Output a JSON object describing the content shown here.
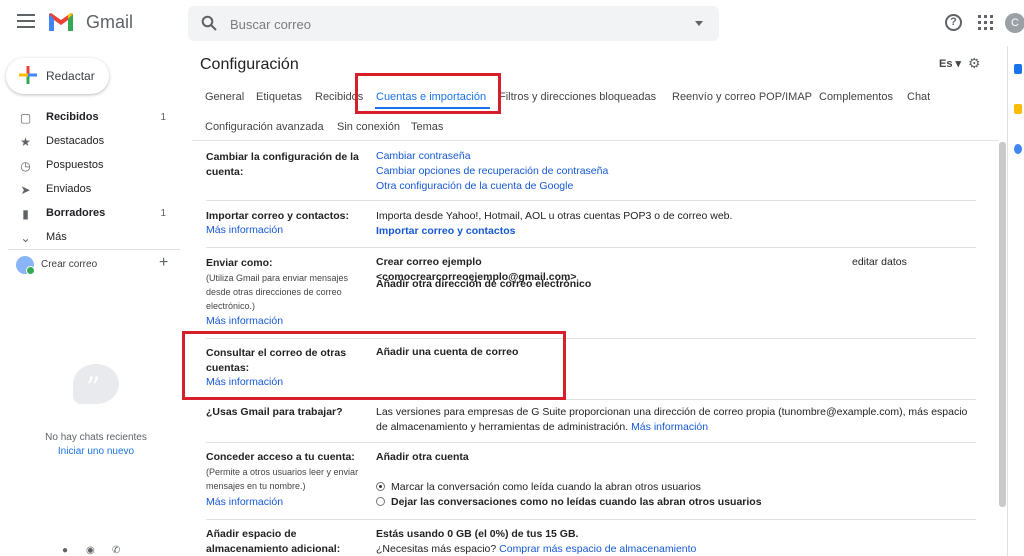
{
  "header": {
    "app_name": "Gmail",
    "search_placeholder": "Buscar correo",
    "account_initial": "C"
  },
  "sidebar": {
    "compose_label": "Redactar",
    "items": [
      {
        "label": "Recibidos",
        "count": "1",
        "icon": "inbox-icon",
        "bold": true
      },
      {
        "label": "Destacados",
        "count": "",
        "icon": "star-icon",
        "bold": false
      },
      {
        "label": "Pospuestos",
        "count": "",
        "icon": "clock-icon",
        "bold": false
      },
      {
        "label": "Enviados",
        "count": "",
        "icon": "send-icon",
        "bold": false
      },
      {
        "label": "Borradores",
        "count": "1",
        "icon": "draft-icon",
        "bold": true
      },
      {
        "label": "Más",
        "count": "",
        "icon": "chevron-down-icon",
        "bold": false
      }
    ],
    "hangouts_user": "Crear correo",
    "no_chats": "No hay chats recientes",
    "start_new": "Iniciar uno nuevo"
  },
  "main": {
    "title": "Configuración",
    "lang": "Es",
    "tabs": [
      "General",
      "Etiquetas",
      "Recibidos",
      "Cuentas e importación",
      "Filtros y direcciones bloqueadas",
      "Reenvío y correo POP/IMAP",
      "Complementos",
      "Chat"
    ],
    "tabs_row2": [
      "Configuración avanzada",
      "Sin conexión",
      "Temas"
    ],
    "active_tab": "Cuentas e importación"
  },
  "sections": {
    "change": {
      "label": "Cambiar la configuración de la cuenta:",
      "links": [
        "Cambiar contraseña",
        "Cambiar opciones de recuperación de contraseña",
        "Otra configuración de la cuenta de Google"
      ]
    },
    "import": {
      "label": "Importar correo y contactos:",
      "more": "Más información",
      "text": "Importa desde Yahoo!, Hotmail, AOL u otras cuentas POP3 o de correo web.",
      "action": "Importar correo y contactos"
    },
    "send_as": {
      "label": "Enviar como:",
      "sub": "(Utiliza Gmail para enviar mensajes desde otras direcciones de correo electrónico.)",
      "more": "Más información",
      "identity": "Crear correo ejemplo <comocrearcorreoejemplo@gmail.com>",
      "edit": "editar datos",
      "action": "Añadir otra dirección de correo electrónico"
    },
    "check_mail": {
      "label": "Consultar el correo de otras cuentas:",
      "more": "Más información",
      "action": "Añadir una cuenta de correo"
    },
    "work": {
      "label": "¿Usas Gmail para trabajar?",
      "text": "Las versiones para empresas de G Suite proporcionan una dirección de correo propia (tunombre@example.com), más espacio de almacenamiento y herramientas de administración.",
      "more": "Más información"
    },
    "grant": {
      "label": "Conceder acceso a tu cuenta:",
      "sub": "(Permite a otros usuarios leer y enviar mensajes en tu nombre.)",
      "more": "Más información",
      "action": "Añadir otra cuenta",
      "opt1": "Marcar la conversación como leída cuando la abran otros usuarios",
      "opt2": "Dejar las conversaciones como no leídas cuando las abran otros usuarios"
    },
    "storage": {
      "label": "Añadir espacio de almacenamiento adicional:",
      "usage": "Estás usando 0 GB (el 0%) de tus 15 GB.",
      "question": "¿Necesitas más espacio?",
      "action": "Comprar más espacio de almacenamiento"
    }
  },
  "colors": {
    "accent": "#1a73e8",
    "highlight_box": "#d61f2b"
  }
}
